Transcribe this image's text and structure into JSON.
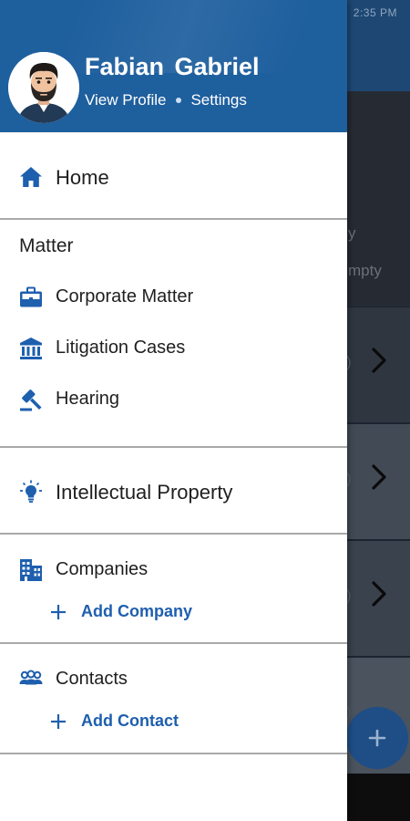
{
  "colors": {
    "brand": "#1e5f9e",
    "icon_blue": "#1e5fae",
    "divider": "#a9a9a9"
  },
  "status_bar": {
    "time": "2:35 PM"
  },
  "background_screen": {
    "hero_line1": "y",
    "hero_line2": "mpty",
    "card_paren": ")"
  },
  "drawer": {
    "user_name": "Fabian Gabriel",
    "view_profile": "View Profile",
    "settings": "Settings",
    "home": {
      "label": "Home",
      "icon": "home-icon"
    },
    "matter_section": {
      "title": "Matter",
      "items": [
        {
          "label": "Corporate Matter",
          "icon": "briefcase-icon"
        },
        {
          "label": "Litigation Cases",
          "icon": "courthouse-icon"
        },
        {
          "label": "Hearing",
          "icon": "gavel-icon"
        }
      ]
    },
    "intellectual_property": {
      "label": "Intellectual Property",
      "icon": "lightbulb-icon"
    },
    "companies": {
      "label": "Companies",
      "add_label": "Add Company",
      "icon": "buildings-icon"
    },
    "contacts": {
      "label": "Contacts",
      "add_label": "Add Contact",
      "icon": "people-icon"
    }
  }
}
